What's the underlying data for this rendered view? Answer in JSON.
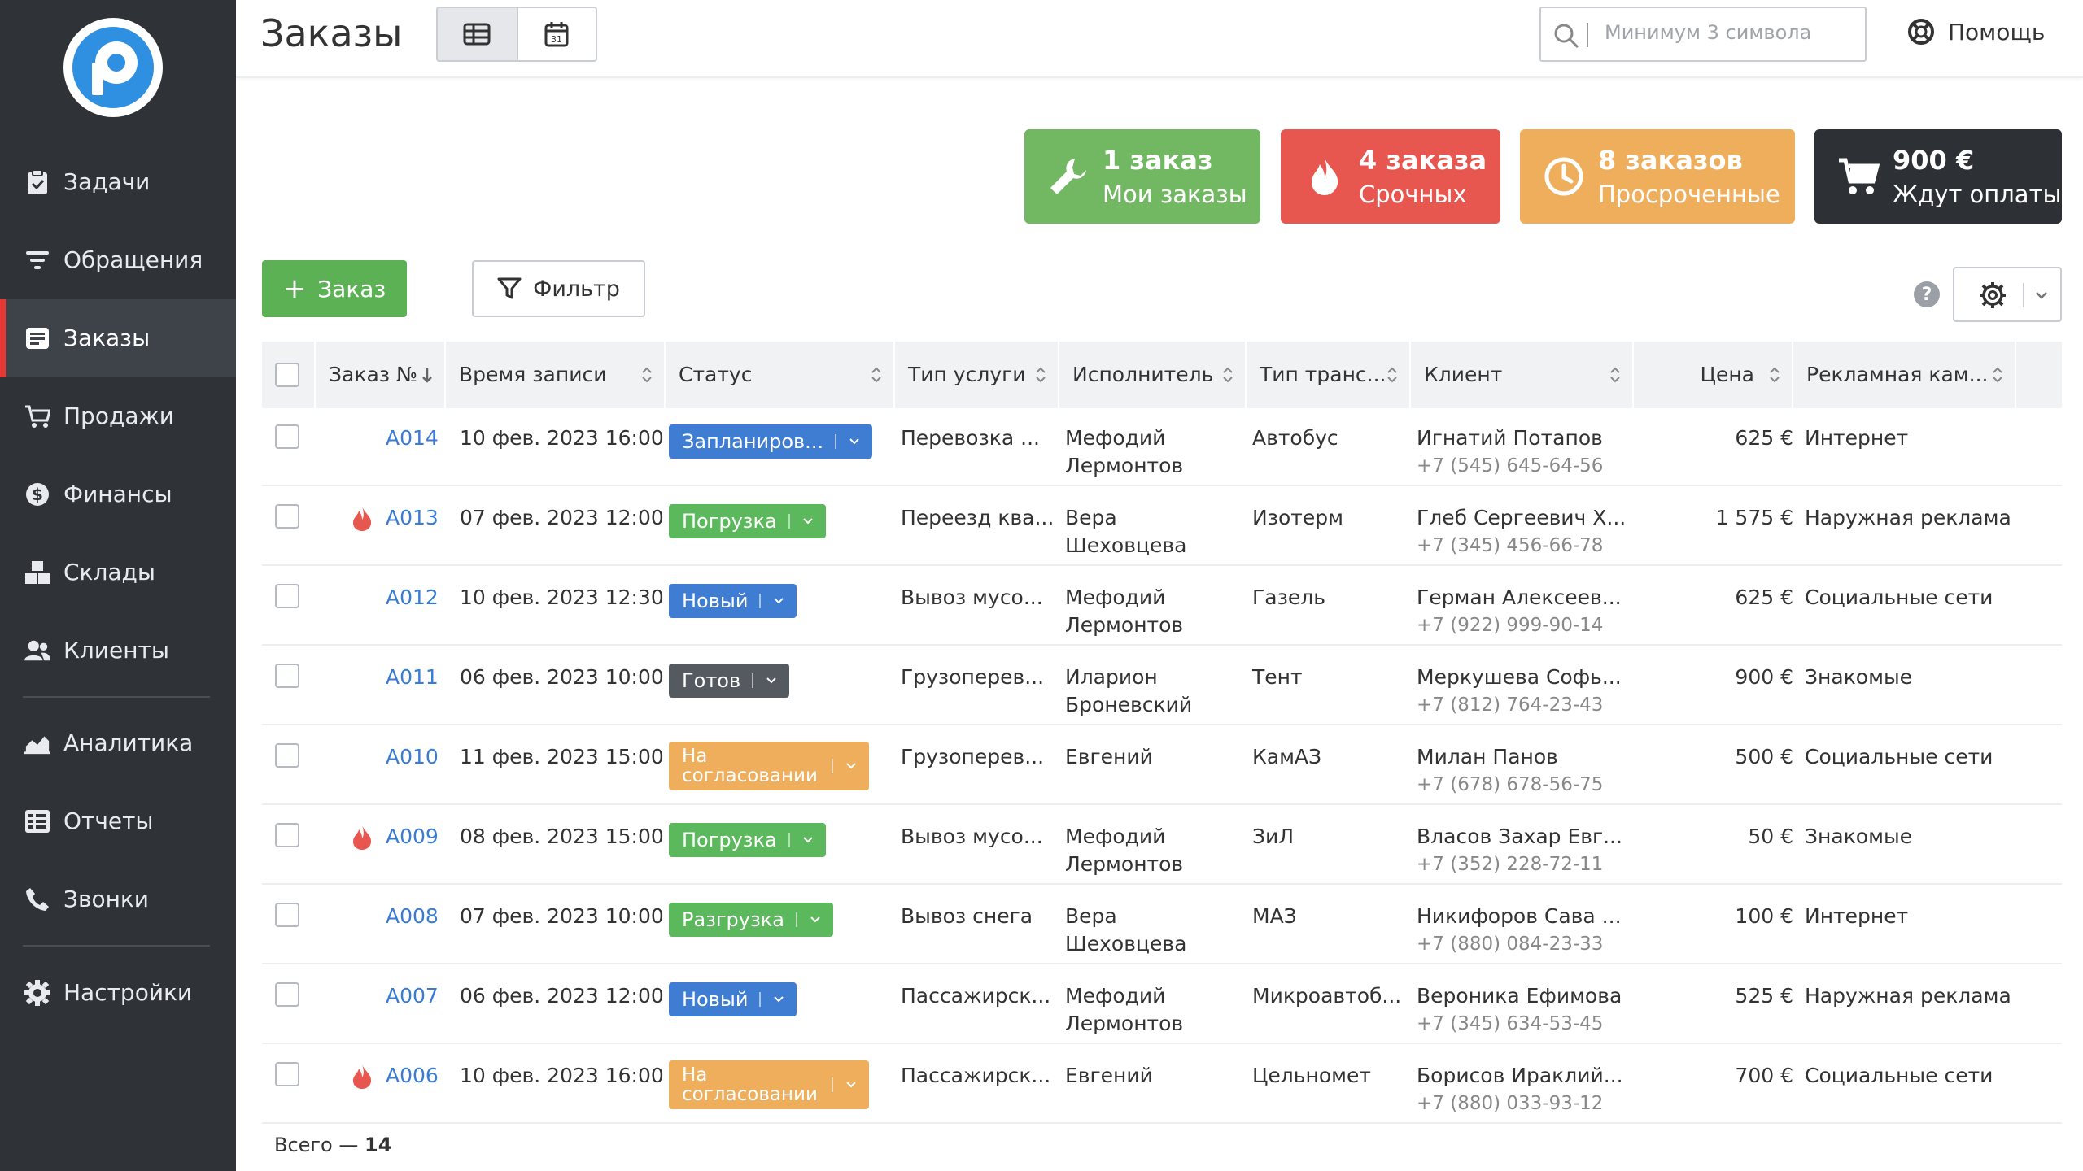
{
  "sidebar": {
    "items": [
      {
        "label": "Задачи",
        "icon": "clipboard-check-icon"
      },
      {
        "label": "Обращения",
        "icon": "filter-lines-icon"
      },
      {
        "label": "Заказы",
        "icon": "order-list-icon",
        "active": true
      },
      {
        "label": "Продажи",
        "icon": "cart-icon"
      },
      {
        "label": "Финансы",
        "icon": "dollar-circle-icon"
      },
      {
        "label": "Склады",
        "icon": "boxes-icon"
      },
      {
        "label": "Клиенты",
        "icon": "users-icon"
      },
      {
        "label": "Аналитика",
        "icon": "area-chart-icon"
      },
      {
        "label": "Отчеты",
        "icon": "report-list-icon"
      },
      {
        "label": "Звонки",
        "icon": "phone-icon"
      },
      {
        "label": "Настройки",
        "icon": "gear-icon"
      }
    ]
  },
  "header": {
    "title": "Заказы",
    "calendar_day": "31",
    "search_placeholder": "Минимум 3 символа",
    "help_label": "Помощь"
  },
  "cards": [
    {
      "title": "1 заказ",
      "subtitle": "Мои заказы",
      "color": "#72b862",
      "icon": "wrench-icon"
    },
    {
      "title": "4 заказа",
      "subtitle": "Срочных",
      "color": "#e8574f",
      "icon": "fire-icon"
    },
    {
      "title": "8 заказов",
      "subtitle": "Просроченные",
      "color": "#efae5b",
      "icon": "clock-icon"
    },
    {
      "title": "900 €",
      "subtitle": "Ждут оплаты",
      "color": "#2d3035",
      "icon": "cart-icon"
    }
  ],
  "toolbar": {
    "add_label": "Заказ",
    "filter_label": "Фильтр",
    "help_mark": "?"
  },
  "table": {
    "columns": [
      "Заказ №",
      "Время записи",
      "Статус",
      "Тип услуги",
      "Исполнитель",
      "Тип транс...",
      "Клиент",
      "Цена",
      "Рекламная кам..."
    ],
    "rows": [
      {
        "no": "A014",
        "urgent": false,
        "time": "10 фев. 2023 16:00",
        "status": "Запланиров...",
        "status_color": "blue",
        "service": "Перевозка ...",
        "exec1": "Мефодий",
        "exec2": "Лермонтов",
        "transport": "Автобус",
        "client": "Игнатий Потапов",
        "phone": "+7 (545) 645-64-56",
        "price": "625 €",
        "ad": "Интернет"
      },
      {
        "no": "A013",
        "urgent": true,
        "time": "07 фев. 2023 12:00",
        "status": "Погрузка",
        "status_color": "green",
        "service": "Переезд ква...",
        "exec1": "Вера",
        "exec2": "Шеховцева",
        "transport": "Изотерм",
        "client": "Глеб Сергеевич Х...",
        "phone": "+7 (345) 456-66-78",
        "price": "1 575 €",
        "ad": "Наружная реклама"
      },
      {
        "no": "A012",
        "urgent": false,
        "time": "10 фев. 2023 12:30",
        "status": "Новый",
        "status_color": "blue",
        "service": "Вывоз мусо...",
        "exec1": "Мефодий",
        "exec2": "Лермонтов",
        "transport": "Газель",
        "client": "Герман Алексеев...",
        "phone": "+7 (922) 999-90-14",
        "price": "625 €",
        "ad": "Социальные сети"
      },
      {
        "no": "A011",
        "urgent": false,
        "time": "06 фев. 2023 10:00",
        "status": "Готов",
        "status_color": "dark",
        "service": "Грузоперев...",
        "exec1": "Иларион",
        "exec2": "Броневский",
        "transport": "Тент",
        "client": "Меркушева Софь...",
        "phone": "+7 (812) 764-23-43",
        "price": "900 €",
        "ad": "Знакомые"
      },
      {
        "no": "A010",
        "urgent": false,
        "time": "11 фев. 2023 15:00",
        "status": "На согласовании",
        "status_color": "orange",
        "service": "Грузоперев...",
        "exec1": "Евгений",
        "exec2": "",
        "transport": "КамАЗ",
        "client": "Милан Панов",
        "phone": "+7 (678) 678-56-75",
        "price": "500 €",
        "ad": "Социальные сети"
      },
      {
        "no": "A009",
        "urgent": true,
        "time": "08 фев. 2023 15:00",
        "status": "Погрузка",
        "status_color": "green",
        "service": "Вывоз мусо...",
        "exec1": "Мефодий",
        "exec2": "Лермонтов",
        "transport": "ЗиЛ",
        "client": "Власов Захар Евг...",
        "phone": "+7 (352) 228-72-11",
        "price": "50 €",
        "ad": "Знакомые"
      },
      {
        "no": "A008",
        "urgent": false,
        "time": "07 фев. 2023 10:00",
        "status": "Разгрузка",
        "status_color": "green",
        "service": "Вывоз снега",
        "exec1": "Вера",
        "exec2": "Шеховцева",
        "transport": "МАЗ",
        "client": "Никифоров Сава ...",
        "phone": "+7 (880) 084-23-33",
        "price": "100 €",
        "ad": "Интернет"
      },
      {
        "no": "A007",
        "urgent": false,
        "time": "06 фев. 2023 12:00",
        "status": "Новый",
        "status_color": "blue",
        "service": "Пассажирск...",
        "exec1": "Мефодий",
        "exec2": "Лермонтов",
        "transport": "Микроавтоб...",
        "client": "Вероника Ефимова",
        "phone": "+7 (345) 634-53-45",
        "price": "525 €",
        "ad": "Наружная реклама"
      },
      {
        "no": "A006",
        "urgent": true,
        "time": "10 фев. 2023 16:00",
        "status": "На согласовании",
        "status_color": "orange",
        "service": "Пассажирск...",
        "exec1": "Евгений",
        "exec2": "",
        "transport": "Цельномет",
        "client": "Борисов Ираклий...",
        "phone": "+7 (880) 033-93-12",
        "price": "700 €",
        "ad": "Социальные сети"
      }
    ]
  },
  "footer": {
    "total_label": "Всего —",
    "total_count": "14"
  }
}
